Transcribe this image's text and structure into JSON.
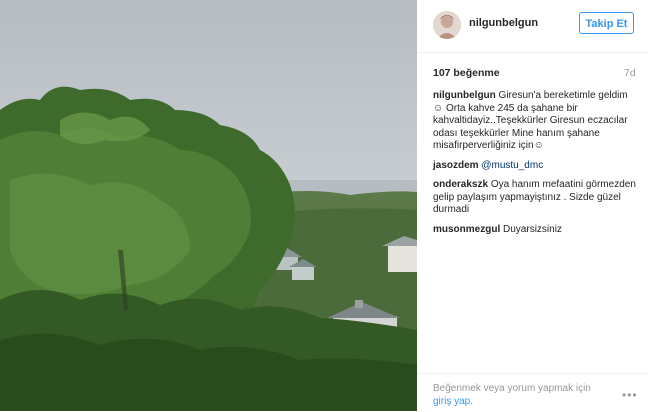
{
  "post": {
    "username": "nilgunbelgun",
    "follow_label": "Takip Et",
    "likes": "107 beğenme",
    "age": "7d"
  },
  "comments": [
    {
      "user": "nilgunbelgun",
      "text": "Giresun'a bereketimle geldim ☺ Orta kahve 245 da şahane bir kahvaltidayiz..Teşekkürler Giresun eczacılar odası teşekkürler Mine hanım şahane misafirperverliğiniz için☺"
    },
    {
      "user": "jasozdem",
      "mention": "@mustu_dmc",
      "text": ""
    },
    {
      "user": "onderakszk",
      "text": "Oya hanım mefaatini görmezden gelip paylaşım yapmayiştınız . Sizde güzel durmadi"
    },
    {
      "user": "musonmezgul",
      "text": "Duyarsizsiniz"
    }
  ],
  "footer": {
    "login_text": "Beğenmek veya yorum yapmak için",
    "login_link": "giriş yap.",
    "more_icon": "ellipsis-icon"
  }
}
